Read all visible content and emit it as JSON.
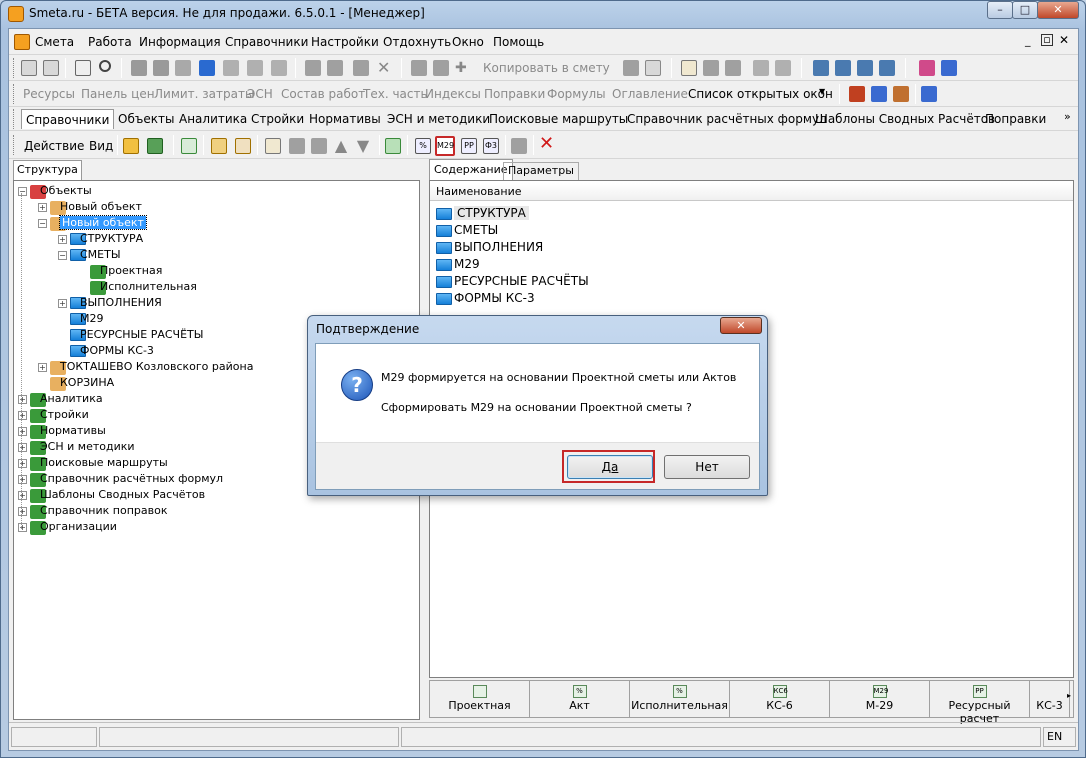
{
  "window": {
    "title": "Smeta.ru - БЕТА версия. Не для продажи.  6.5.0.1   - [Менеджер]"
  },
  "menu": [
    "Смета",
    "Работа",
    "Информация",
    "Справочники",
    "Настройки",
    "Отдохнуть",
    "Окно",
    "Помощь"
  ],
  "toolbar2": {
    "copy_label": "Копировать в смету"
  },
  "toolbar3": {
    "items": [
      "Ресурсы",
      "Панель цен",
      "Лимит. затраты",
      "ЭСН",
      "Состав работ",
      "Тех. часть",
      "Индексы",
      "Поправки",
      "Формулы",
      "Оглавление"
    ],
    "open_windows": "Список открытых окон"
  },
  "tabs": [
    "Справочники",
    "Объекты",
    "Аналитика",
    "Стройки",
    "Нормативы",
    "ЭСН и методики",
    "Поисковые маршруты",
    "Справочник расчётных формул",
    "Шаблоны Сводных Расчётов",
    "Поправки"
  ],
  "toolbar5": {
    "action": "Действие",
    "view": "Вид"
  },
  "left_tab": "Структура",
  "tree": [
    {
      "label": "Объекты",
      "level": 0
    },
    {
      "label": "Новый объект",
      "level": 1
    },
    {
      "label": "Новый объект",
      "level": 1,
      "selected": true
    },
    {
      "label": "СТРУКТУРА",
      "level": 2
    },
    {
      "label": "СМЕТЫ",
      "level": 2
    },
    {
      "label": "Проектная",
      "level": 3
    },
    {
      "label": "Исполнительная",
      "level": 3
    },
    {
      "label": "ВЫПОЛНЕНИЯ",
      "level": 2
    },
    {
      "label": "М29",
      "level": 2
    },
    {
      "label": "РЕСУРСНЫЕ РАСЧЁТЫ",
      "level": 2
    },
    {
      "label": "ФОРМЫ КС-3",
      "level": 2
    },
    {
      "label": "ТОКТАШЕВО Козловского района",
      "level": 1
    },
    {
      "label": "КОРЗИНА",
      "level": 1
    },
    {
      "label": "Аналитика",
      "level": 0
    },
    {
      "label": "Стройки",
      "level": 0
    },
    {
      "label": "Нормативы",
      "level": 0
    },
    {
      "label": "ЭСН и методики",
      "level": 0
    },
    {
      "label": "Поисковые маршруты",
      "level": 0
    },
    {
      "label": "Справочник расчётных формул",
      "level": 0
    },
    {
      "label": "Шаблоны Сводных Расчётов",
      "level": 0
    },
    {
      "label": "Справочник поправок",
      "level": 0
    },
    {
      "label": "Организации",
      "level": 0
    }
  ],
  "right_tabs": [
    "Содержание",
    "Параметры"
  ],
  "list_header": "Наименование",
  "list": [
    "СТРУКТУРА",
    "СМЕТЫ",
    "ВЫПОЛНЕНИЯ",
    "М29",
    "РЕСУРСНЫЕ РАСЧЁТЫ",
    "ФОРМЫ КС-3"
  ],
  "bottom_buttons": [
    {
      "label": "Проектная",
      "icon": ""
    },
    {
      "label": "Акт",
      "icon": "%"
    },
    {
      "label": "Исполнительная",
      "icon": "%"
    },
    {
      "label": "КС-6",
      "icon": "КС6"
    },
    {
      "label": "М-29",
      "icon": "М29"
    },
    {
      "label": "Ресурсный расчет",
      "icon": "РР"
    },
    {
      "label": "КС-3",
      "icon": ""
    }
  ],
  "status": {
    "lang": "EN"
  },
  "dialog": {
    "title": "Подтверждение",
    "line1": "М29 формируется на основании Проектной сметы или Актов",
    "line2": "Сформировать М29 на основании Проектной сметы ?",
    "yes": "Да",
    "no": "Нет"
  },
  "colors": {
    "highlight": "#c62828",
    "selection": "#3399ff"
  }
}
